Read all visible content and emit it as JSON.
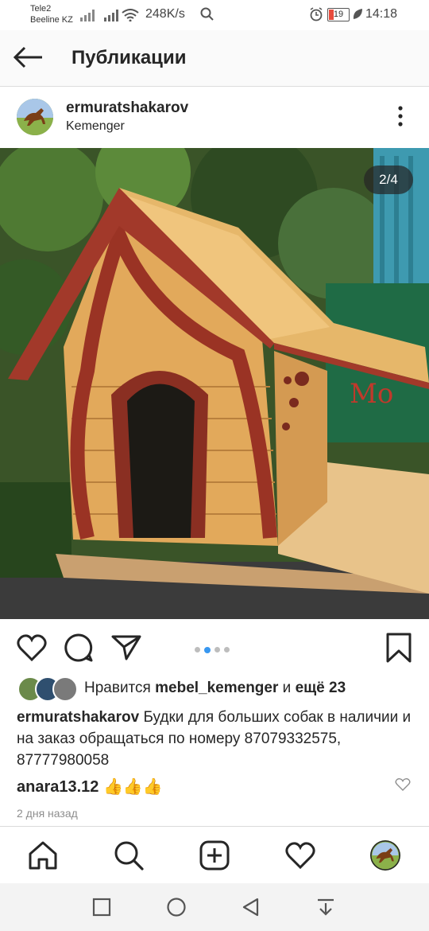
{
  "status_bar": {
    "carrier1": "Tele2",
    "carrier2": "Beeline KZ",
    "speed": "248K/s",
    "battery": "19",
    "time": "14:18"
  },
  "header": {
    "title": "Публикации"
  },
  "post": {
    "username": "ermuratshakarov",
    "location": "Kemenger",
    "photo_counter": "2/4",
    "likes_prefix": "Нравится",
    "likes_user": "mebel_kemenger",
    "likes_and": "и",
    "likes_more": "ещё 23",
    "caption_text": "Будки для больших собак в наличии и на заказ обращаться по номеру 87079332575, 87777980058",
    "comment_user": "anara13.12",
    "comment_text": "👍👍👍",
    "time_ago": "2 дня назад"
  },
  "icons": {
    "like": "heart-icon",
    "comment": "comment-icon",
    "share": "send-icon",
    "save": "bookmark-icon",
    "home": "home-icon",
    "search": "search-icon",
    "add": "add-icon",
    "activity": "heart-icon",
    "profile": "avatar"
  },
  "colors": {
    "accent_dot": "#3897f0",
    "text": "#262626",
    "muted": "#8e8e8e"
  }
}
